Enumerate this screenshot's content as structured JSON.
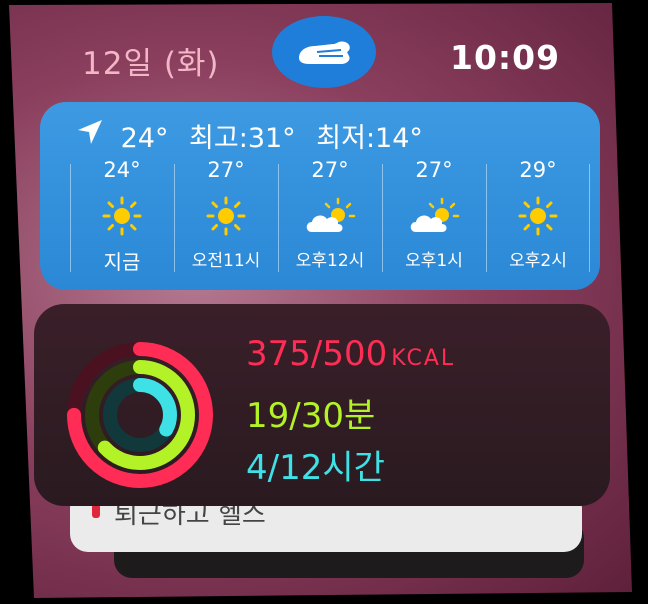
{
  "status_bar": {
    "date": "12일 (화)",
    "time": "10:09"
  },
  "weather": {
    "current_temp": "24°",
    "high": "최고:31°",
    "low": "최저:14°",
    "hours": [
      {
        "temp": "24°",
        "icon": "sun-icon",
        "label": "지금"
      },
      {
        "temp": "27°",
        "icon": "sun-icon",
        "label": "오전11시"
      },
      {
        "temp": "27°",
        "icon": "partly-cloudy-icon",
        "label": "오후12시"
      },
      {
        "temp": "27°",
        "icon": "partly-cloudy-icon",
        "label": "오후1시"
      },
      {
        "temp": "29°",
        "icon": "sun-icon",
        "label": "오후2시"
      }
    ]
  },
  "activity": {
    "move": {
      "value": "375/500",
      "unit": "KCAL",
      "progress": 0.75
    },
    "exercise": {
      "value": "19/30분",
      "progress": 0.63
    },
    "stand": {
      "value": "4/12시간",
      "progress": 0.33
    }
  },
  "back_card": {
    "peek_text": "퇴근하고 헬스"
  },
  "colors": {
    "move": "#ff2d55",
    "exercise": "#b2f227",
    "stand": "#3ee1e6",
    "weather_bg": "#2a88d6"
  }
}
